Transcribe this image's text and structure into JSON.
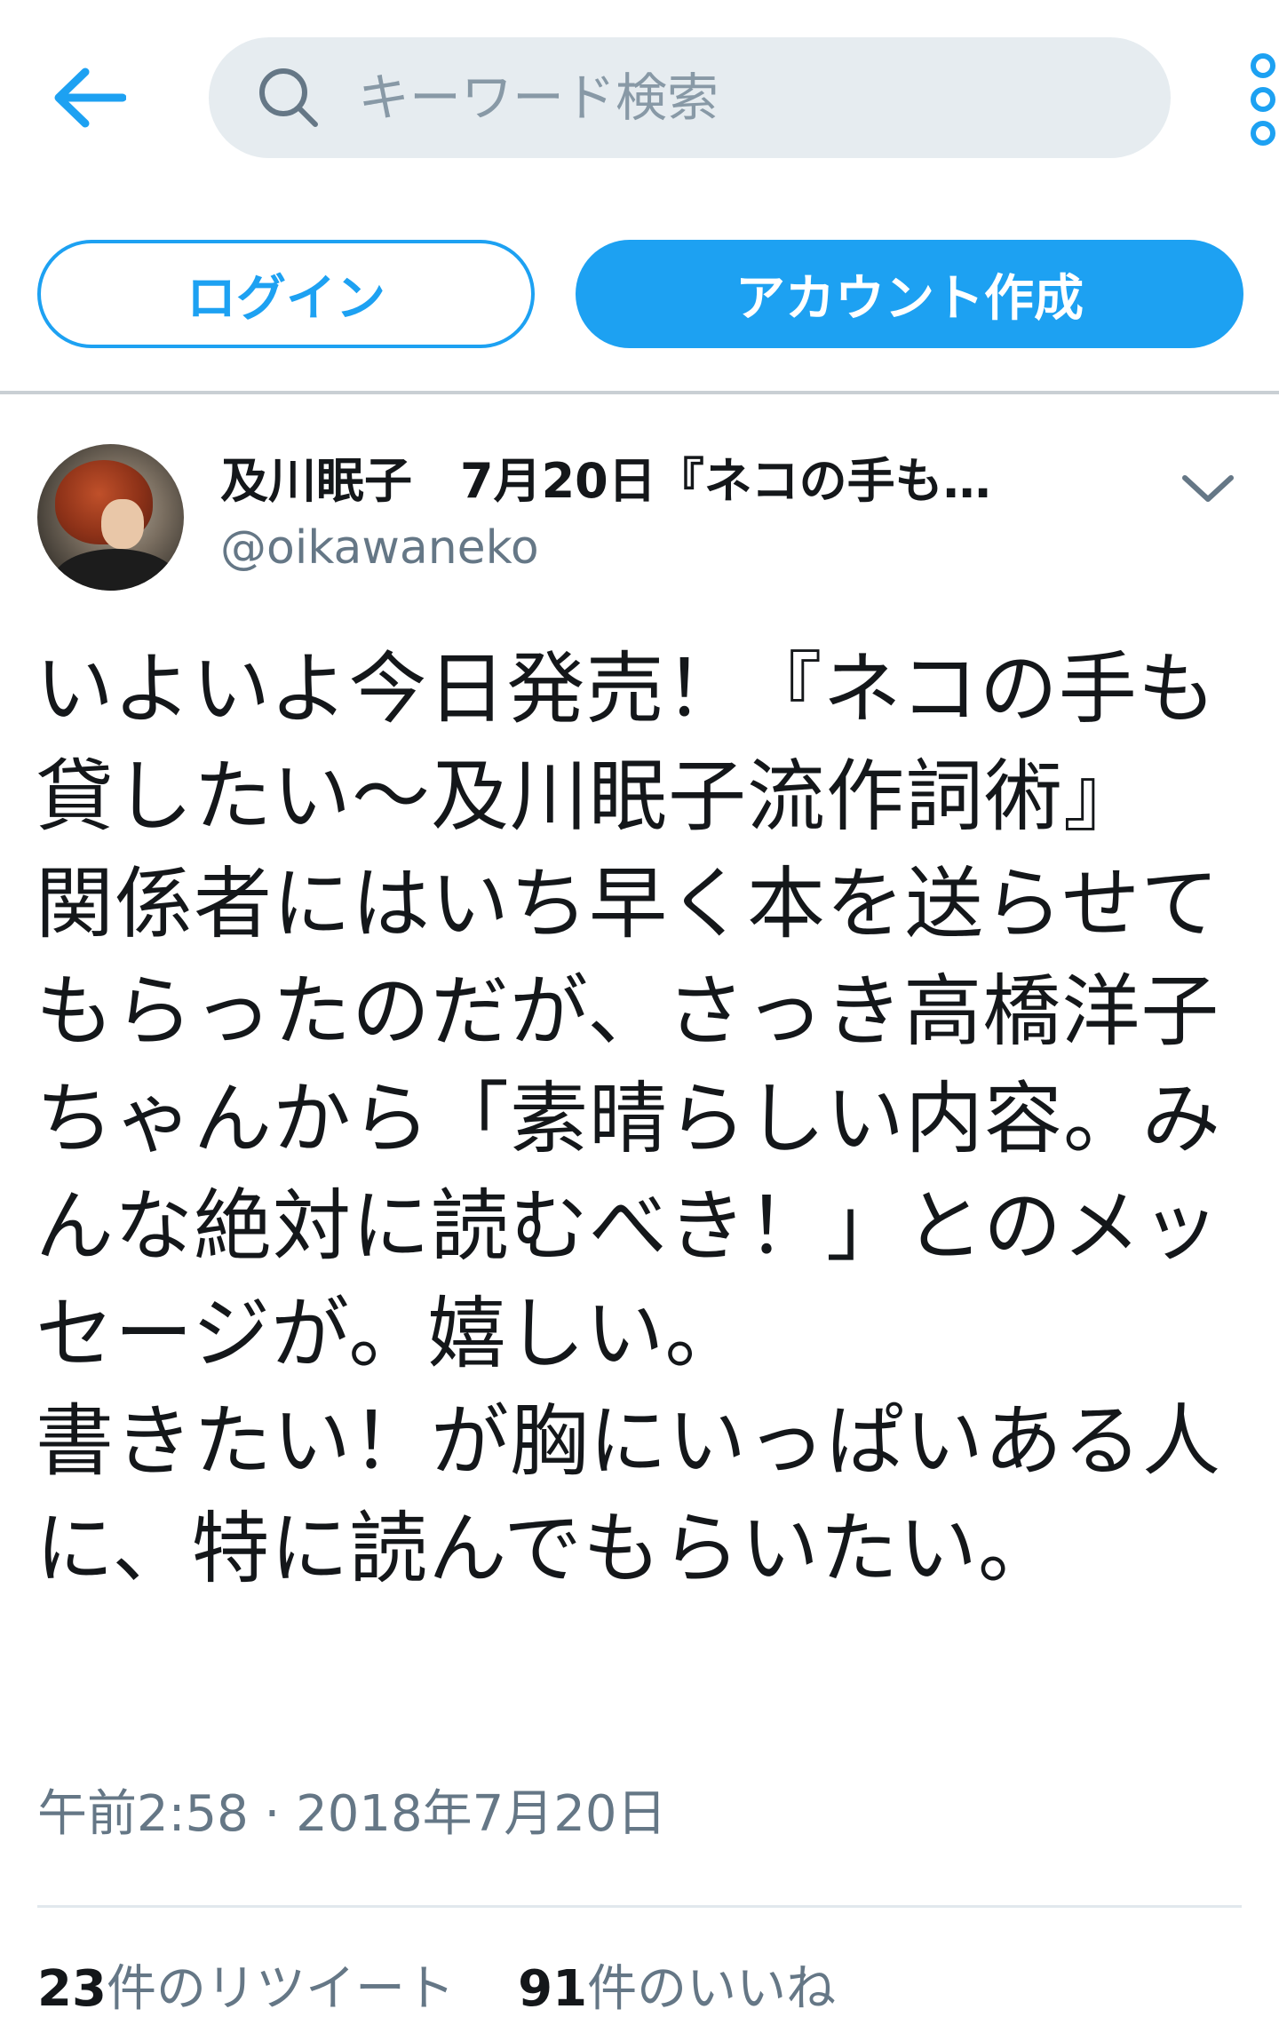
{
  "header": {
    "back_icon": "arrow-left-icon",
    "search": {
      "placeholder": "キーワード検索",
      "value": "",
      "icon": "search-icon"
    },
    "more_icon": "more-vertical-icon"
  },
  "auth": {
    "login_label": "ログイン",
    "signup_label": "アカウント作成"
  },
  "tweet": {
    "display_name": "及川眠子　7月20日『ネコの手も…",
    "handle": "@oikawaneko",
    "menu_icon": "chevron-down-icon",
    "text": "いよいよ今日発売！『ネコの手も貸したい〜及川眠子流作詞術』\n関係者にはいち早く本を送らせてもらったのだが、さっき高橋洋子ちゃんから「素晴らしい内容。みんな絶対に読むべき！」とのメッセージが。嬉しい。\n書きたい！が胸にいっぱいある人に、特に読んでもらいたい。",
    "timestamp": "午前2:58 · 2018年7月20日",
    "retweet_count": "23",
    "retweet_label": "件のリツイート",
    "like_count": "91",
    "like_label": "件のいいね"
  },
  "colors": {
    "accent": "#1da1f2",
    "text_primary": "#14171a",
    "text_secondary": "#657786",
    "search_bg": "#e6ecf0"
  }
}
